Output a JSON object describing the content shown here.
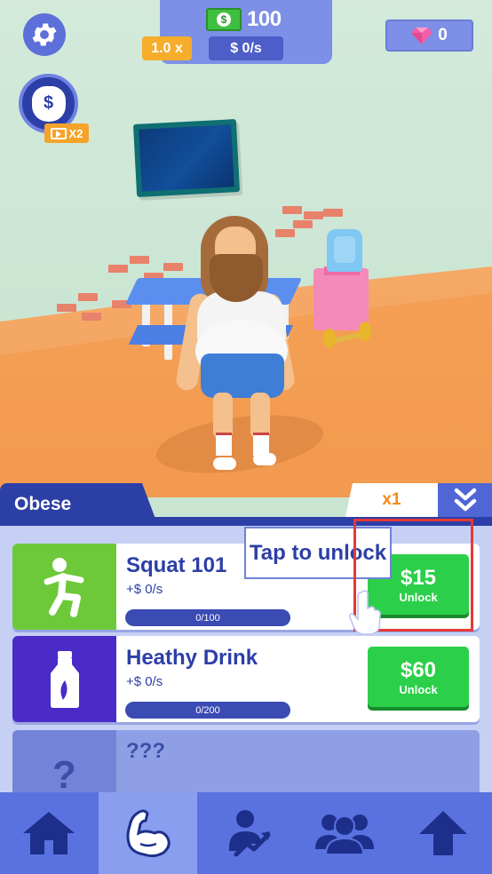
{
  "hud": {
    "cash": "100",
    "multiplier": "1.0 x",
    "income_rate": "$ 0/s",
    "gems": "0",
    "x2_label": "X2"
  },
  "panel": {
    "stage_tab": "Obese",
    "speed_multiplier": "x1"
  },
  "items": [
    {
      "title": "Squat 101",
      "income": "+$ 0/s",
      "progress_text": "0/100",
      "price": "$15",
      "button_label": "Unlock",
      "icon": "squat-figure-icon",
      "color": "#6dc93a"
    },
    {
      "title": "Heathy Drink",
      "income": "+$ 0/s",
      "progress_text": "0/200",
      "price": "$60",
      "button_label": "Unlock",
      "icon": "milk-bottle-icon",
      "color": "#4a2bc8"
    },
    {
      "title": "???",
      "icon": "question-mark-icon",
      "locked": true
    }
  ],
  "tutorial": {
    "tooltip": "Tap to unlock"
  },
  "nav": [
    "home-icon",
    "muscle-arm-icon",
    "person-progress-icon",
    "group-icon",
    "up-arrow-icon"
  ],
  "colors": {
    "primary": "#2c3fa6",
    "nav": "#5a72e0",
    "buy": "#2ccf4a",
    "highlight": "#e53935",
    "accent_orange": "#f5ad2b"
  }
}
